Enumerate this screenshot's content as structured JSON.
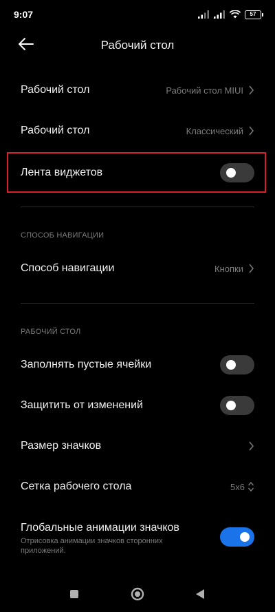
{
  "status_bar": {
    "time": "9:07",
    "battery": "57",
    "icons": [
      "signal-icon",
      "signal-icon",
      "wifi-icon",
      "battery-icon"
    ]
  },
  "header": {
    "title": "Рабочий стол",
    "back_icon": "back-arrow-icon"
  },
  "rows": {
    "desktop_mode": {
      "label": "Рабочий стол",
      "value": "Рабочий стол MIUI"
    },
    "desktop_style": {
      "label": "Рабочий стол",
      "value": "Классический"
    },
    "widgets_feed": {
      "label": "Лента виджетов",
      "enabled": false
    }
  },
  "navigation_section": {
    "header": "СПОСОБ НАВИГАЦИИ",
    "nav_method": {
      "label": "Способ навигации",
      "value": "Кнопки"
    }
  },
  "desktop_section": {
    "header": "РАБОЧИЙ СТОЛ",
    "fill_empty": {
      "label": "Заполнять пустые ячейки",
      "enabled": false
    },
    "lock_layout": {
      "label": "Защитить от изменений",
      "enabled": false
    },
    "icon_size": {
      "label": "Размер значков"
    },
    "grid": {
      "label": "Сетка рабочего стола",
      "value": "5x6"
    },
    "global_animations": {
      "label": "Глобальные анимации значков",
      "subtitle": "Отрисовка анимации значков сторонних приложений.",
      "enabled": true
    }
  },
  "colors": {
    "background": "#000000",
    "accent": "#1a73e8",
    "highlight": "#d9202a"
  },
  "nav_bar": {
    "icons": [
      "recents-square-icon",
      "home-circle-icon",
      "back-triangle-icon"
    ]
  }
}
